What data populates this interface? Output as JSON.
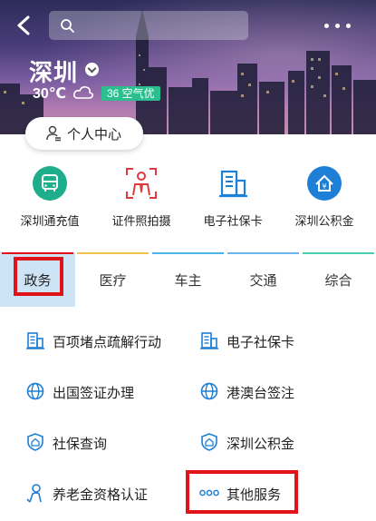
{
  "header": {
    "search": {
      "placeholder": "",
      "icon": "search-icon"
    },
    "city": "深圳",
    "temperature": "30℃",
    "weather_icon": "cloud-icon",
    "aqi": "36 空气优",
    "aqi_color": "#2bbf8f"
  },
  "personal_center": {
    "label": "个人中心",
    "icon": "person-icon"
  },
  "quick_services": [
    {
      "label": "深圳通充值",
      "icon": "bus-card-icon",
      "color": "#1fae8c"
    },
    {
      "label": "证件照拍摄",
      "icon": "id-photo-icon",
      "color": "#e0393b"
    },
    {
      "label": "电子社保卡",
      "icon": "building-icon",
      "color": "#1e7fd6"
    },
    {
      "label": "深圳公积金",
      "icon": "housing-fund-icon",
      "color": "#1e7fd6"
    }
  ],
  "tabs": [
    {
      "label": "政务",
      "accent": "#e0131b",
      "active": true
    },
    {
      "label": "医疗",
      "accent": "#f0c14b"
    },
    {
      "label": "车主",
      "accent": "#4bb4e8"
    },
    {
      "label": "交通",
      "accent": "#6bb8f0"
    },
    {
      "label": "综合",
      "accent": "#4ad0b0"
    }
  ],
  "services": [
    {
      "label": "百项堵点疏解行动",
      "icon": "building-icon"
    },
    {
      "label": "电子社保卡",
      "icon": "building-icon"
    },
    {
      "label": "出国签证办理",
      "icon": "globe-icon"
    },
    {
      "label": "港澳台签注",
      "icon": "globe-icon"
    },
    {
      "label": "社保查询",
      "icon": "house-shield-icon"
    },
    {
      "label": "深圳公积金",
      "icon": "house-shield-icon"
    },
    {
      "label": "养老金资格认证",
      "icon": "person-outline-icon"
    },
    {
      "label": "其他服务",
      "icon": "more-dots-icon"
    }
  ]
}
